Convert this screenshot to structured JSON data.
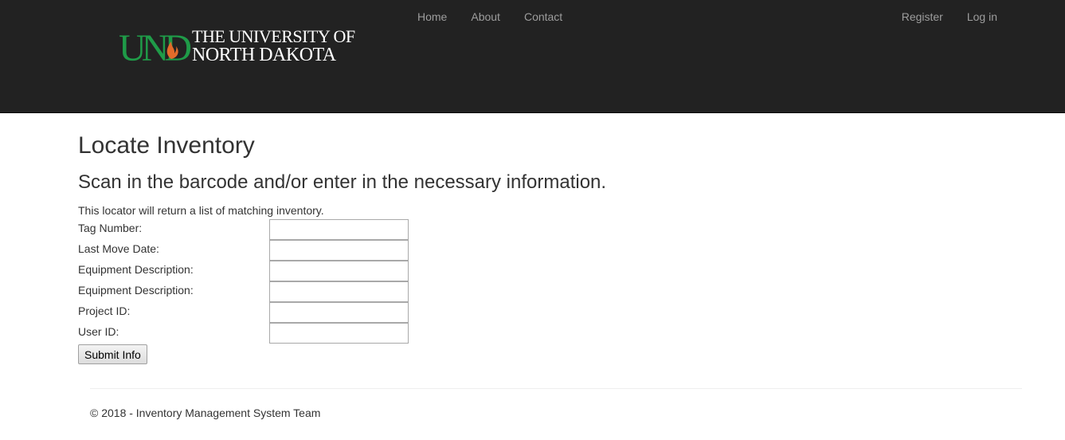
{
  "header": {
    "logo": {
      "mark": "UND",
      "line1": "THE UNIVERSITY OF",
      "line2": "NORTH DAKOTA",
      "colors": {
        "green": "#1f9b48",
        "flame": "#e36b2a",
        "text": "#ffffff"
      }
    },
    "nav_left": [
      "Home",
      "About",
      "Contact"
    ],
    "nav_right": [
      "Register",
      "Log in"
    ],
    "background": "#222222",
    "link_color": "#9d9d9d"
  },
  "main": {
    "title": "Locate Inventory",
    "subtitle": "Scan in the barcode and/or enter in the necessary information.",
    "note": "This locator will return a list of matching inventory.",
    "fields": [
      {
        "label": "Tag Number:",
        "value": ""
      },
      {
        "label": "Last Move Date:",
        "value": ""
      },
      {
        "label": "Equipment Description:",
        "value": ""
      },
      {
        "label": "Equipment Description:",
        "value": ""
      },
      {
        "label": "Project ID:",
        "value": ""
      },
      {
        "label": "User ID:",
        "value": ""
      }
    ],
    "submit_label": "Submit Info"
  },
  "footer": {
    "text": "© 2018 - Inventory Management System Team"
  }
}
